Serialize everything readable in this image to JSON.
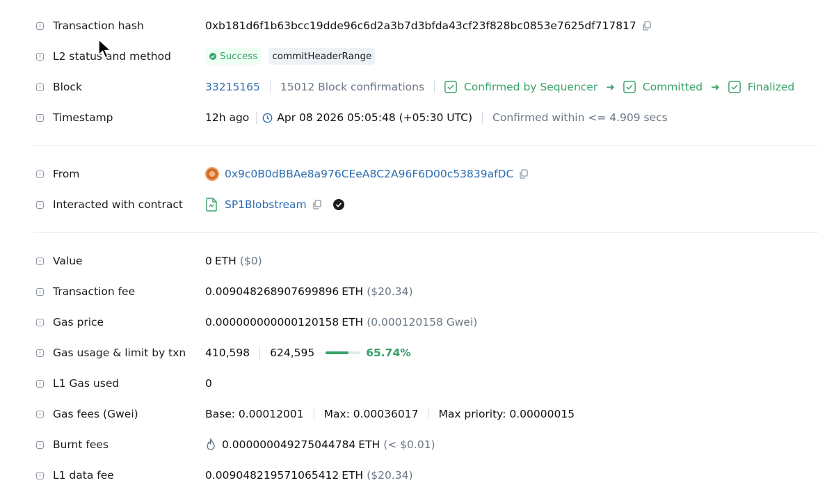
{
  "rows": {
    "tx_hash": {
      "label": "Transaction hash",
      "value": "0xb181d6f1b63bcc19dde96c6d2a3b7d3bfda43cf23f828bc0853e7625df717817"
    },
    "status": {
      "label": "L2 status and method",
      "status": "Success",
      "method": "commitHeaderRange"
    },
    "block": {
      "label": "Block",
      "number": "33215165",
      "confirmations": "15012 Block confirmations",
      "steps": [
        "Confirmed by Sequencer",
        "Committed",
        "Finalized"
      ]
    },
    "timestamp": {
      "label": "Timestamp",
      "ago": "12h ago",
      "datetime": "Apr 08 2026 05:05:48 (+05:30 UTC)",
      "confirmed": "Confirmed within <= 4.909 secs"
    },
    "from": {
      "label": "From",
      "address": "0x9c0B0dBBAe8a976CEeA8C2A96F6D00c53839afDC"
    },
    "contract": {
      "label": "Interacted with contract",
      "name": "SP1Blobstream"
    },
    "value": {
      "label": "Value",
      "amount": "0",
      "unit": "ETH",
      "usd": "($0)"
    },
    "fee": {
      "label": "Transaction fee",
      "amount": "0.009048268907699896",
      "unit": "ETH",
      "usd": "($20.34)"
    },
    "gas_price": {
      "label": "Gas price",
      "amount": "0.000000000000120158",
      "unit": "ETH",
      "gwei": "(0.000120158 Gwei)"
    },
    "gas_usage": {
      "label": "Gas usage & limit by txn",
      "used": "410,598",
      "limit": "624,595",
      "percent": "65.74%",
      "fraction": 0.6574
    },
    "l1_gas": {
      "label": "L1 Gas used",
      "value": "0"
    },
    "gas_fees": {
      "label": "Gas fees (Gwei)",
      "base": "Base: 0.00012001",
      "max": "Max: 0.00036017",
      "priority": "Max priority: 0.00000015"
    },
    "burnt": {
      "label": "Burnt fees",
      "amount": "0.000000049275044784",
      "unit": "ETH",
      "usd": "(< $0.01)"
    },
    "l1_fee": {
      "label": "L1 data fee",
      "amount": "0.009048219571065412",
      "unit": "ETH",
      "usd": "($20.34)"
    }
  },
  "icons": {
    "info": "info-icon",
    "copy": "copy-icon",
    "check": "check-box-icon",
    "clock": "clock-icon",
    "contract": "contract-file-icon",
    "verified": "verified-check-icon",
    "flame": "flame-icon",
    "cursor": "mouse-cursor-icon"
  },
  "colors": {
    "link": "#2b6cb0",
    "success": "#38a169",
    "muted": "#6b7685"
  }
}
